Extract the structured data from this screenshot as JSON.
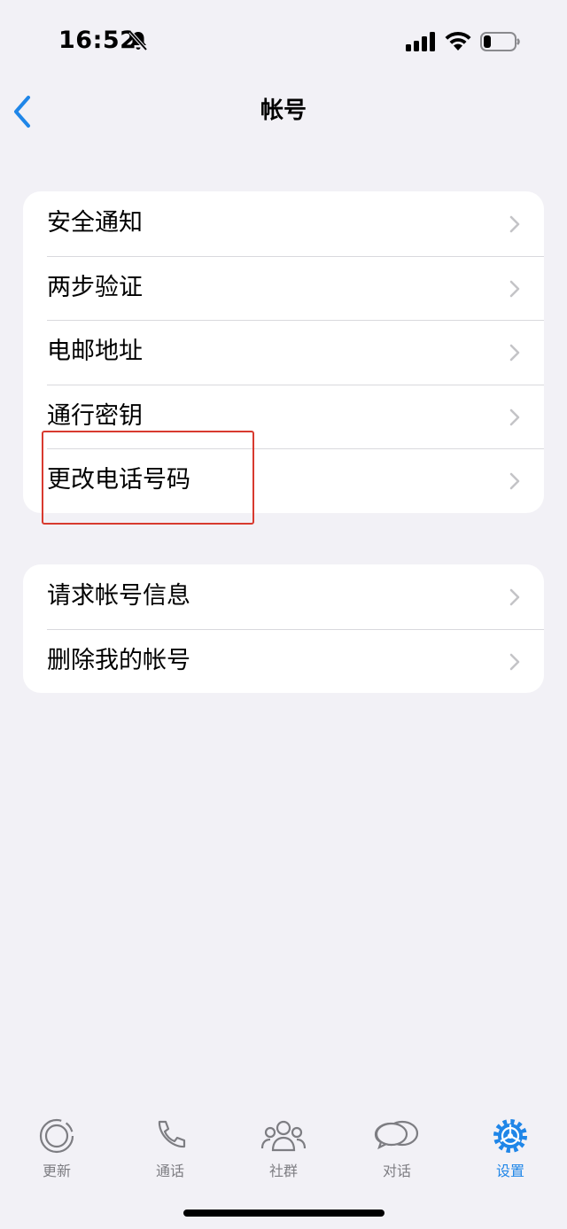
{
  "status_bar": {
    "time": "16:52"
  },
  "nav": {
    "title": "帐号"
  },
  "groups": [
    {
      "items": [
        {
          "label": "安全通知"
        },
        {
          "label": "两步验证"
        },
        {
          "label": "电邮地址"
        },
        {
          "label": "通行密钥"
        },
        {
          "label": "更改电话号码"
        }
      ]
    },
    {
      "items": [
        {
          "label": "请求帐号信息"
        },
        {
          "label": "删除我的帐号"
        }
      ]
    }
  ],
  "tabs": [
    {
      "label": "更新",
      "icon": "updates-icon"
    },
    {
      "label": "通话",
      "icon": "phone-icon"
    },
    {
      "label": "社群",
      "icon": "communities-icon"
    },
    {
      "label": "对话",
      "icon": "chats-icon"
    },
    {
      "label": "设置",
      "icon": "settings-icon",
      "active": true
    }
  ],
  "colors": {
    "accent": "#1f86e8",
    "background": "#f2f1f6",
    "annotation": "#d83a2f"
  }
}
